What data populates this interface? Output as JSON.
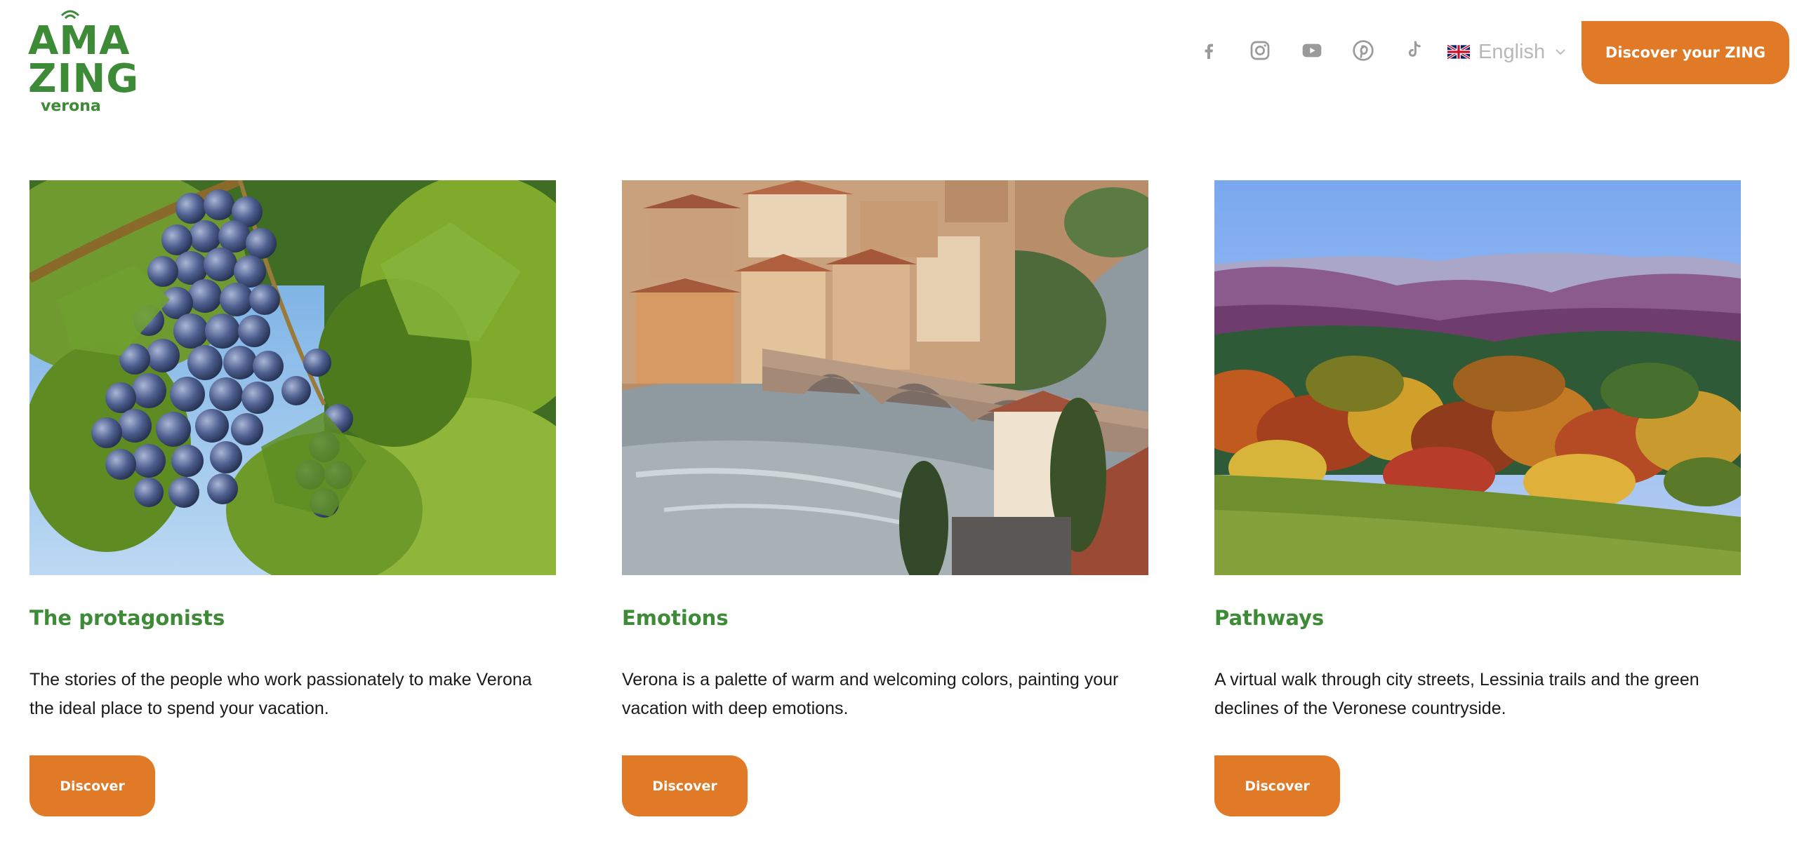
{
  "logo": {
    "line1": "AMA",
    "line2": "ZING",
    "line3": "verona"
  },
  "header": {
    "social_icons": [
      "facebook-icon",
      "instagram-icon",
      "youtube-icon",
      "pinterest-icon",
      "tiktok-icon"
    ],
    "language": {
      "label": "English",
      "flag": "uk-flag-icon"
    },
    "cta_label": "Discover your ZING"
  },
  "colors": {
    "brand_green": "#3d8b37",
    "brand_orange": "#e07a27"
  },
  "cards": [
    {
      "title": "The protagonists",
      "text": "The stories of the people who work passionately to make Verona the ideal place to spend your vacation.",
      "button": "Discover",
      "image": "grape-vine-photo"
    },
    {
      "title": "Emotions",
      "text": "Verona is a palette of warm and welcoming colors, painting your vacation with deep emotions.",
      "button": "Discover",
      "image": "verona-bridge-river-photo"
    },
    {
      "title": "Pathways",
      "text": "A virtual walk through city streets, Lessinia trails and the green declines of the Veronese countryside.",
      "button": "Discover",
      "image": "autumn-hills-forest-photo"
    }
  ]
}
